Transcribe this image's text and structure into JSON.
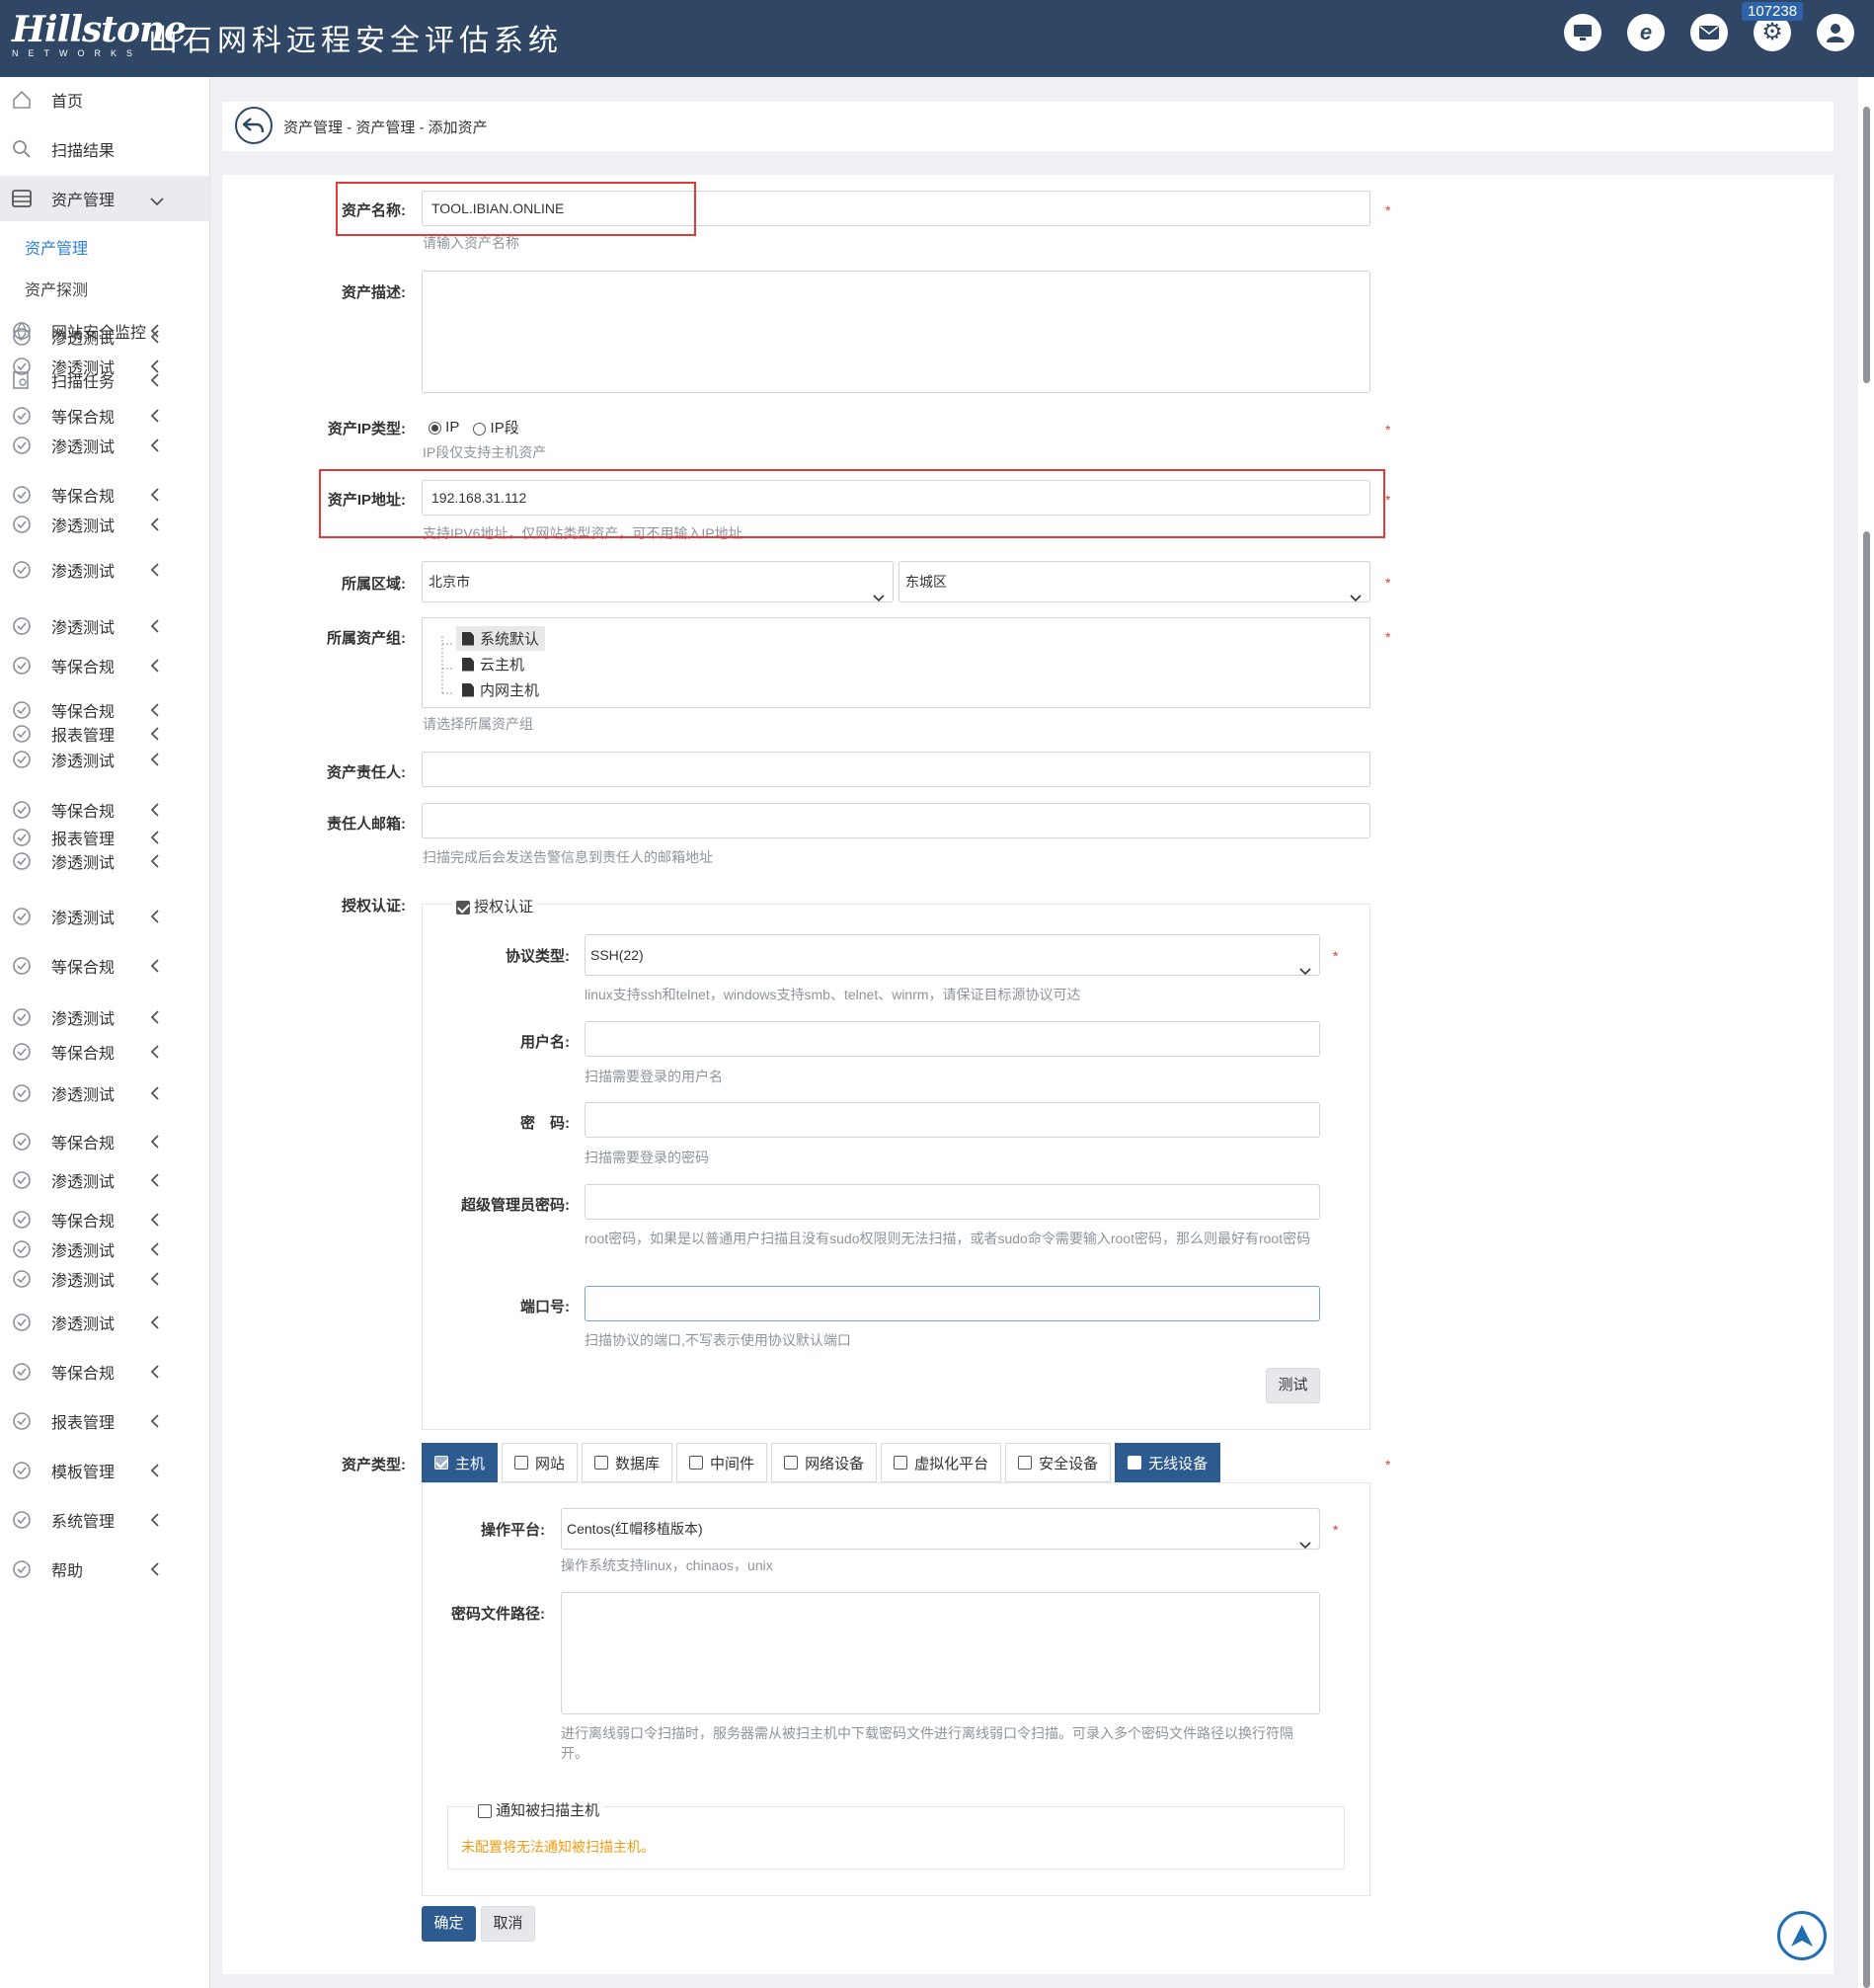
{
  "header": {
    "brand": "Hillstone",
    "brand_sub": "NETWORKS",
    "title": "山石网科远程安全评估系统",
    "badge_count": "107238",
    "icons": [
      "monitor-icon",
      "ie-icon",
      "mail-icon",
      "gear-icon",
      "user-icon"
    ]
  },
  "sidebar": {
    "items": [
      {
        "label": "首页",
        "icon": "home-icon"
      },
      {
        "label": "扫描结果",
        "icon": "search-icon"
      },
      {
        "label": "资产管理",
        "icon": "server-icon"
      },
      {
        "label": "网站安全监控",
        "icon": "globe-icon"
      },
      {
        "label": "扫描任务",
        "icon": "scan-task-icon"
      },
      {
        "label": "渗透测试",
        "icon": "pentest-icon"
      },
      {
        "label": "等保合规",
        "icon": "shield-icon"
      },
      {
        "label": "报表管理",
        "icon": "report-icon"
      },
      {
        "label": "模板管理",
        "icon": "template-icon"
      },
      {
        "label": "系统管理",
        "icon": "gear-icon"
      },
      {
        "label": "帮助",
        "icon": "help-icon"
      }
    ],
    "sub_items": [
      {
        "label": "资产管理"
      },
      {
        "label": "资产探测"
      }
    ]
  },
  "breadcrumb": "资产管理 - 资产管理 - 添加资产",
  "form": {
    "asset_name": {
      "label": "资产名称:",
      "value": "TOOL.IBIAN.ONLINE",
      "help": "请输入资产名称"
    },
    "asset_desc": {
      "label": "资产描述:",
      "value": ""
    },
    "ip_type": {
      "label": "资产IP类型:",
      "options": [
        "IP",
        "IP段"
      ],
      "selected": "IP",
      "help": "IP段仅支持主机资产"
    },
    "ip_addr": {
      "label": "资产IP地址:",
      "value": "192.168.31.112",
      "help": "支持IPV6地址，仅网站类型资产，可不用输入IP地址"
    },
    "region": {
      "label": "所属区域:",
      "city": "北京市",
      "district": "东城区"
    },
    "group": {
      "label": "所属资产组:",
      "items": [
        "系统默认",
        "云主机",
        "内网主机"
      ],
      "help": "请选择所属资产组"
    },
    "owner": {
      "label": "资产责任人:",
      "value": ""
    },
    "email": {
      "label": "责任人邮箱:",
      "value": "",
      "help": "扫描完成后会发送告警信息到责任人的邮箱地址"
    },
    "auth": {
      "label": "授权认证:",
      "checkbox_label": "授权认证",
      "checked": true,
      "protocol": {
        "label": "协议类型:",
        "value": "SSH(22)",
        "help": "linux支持ssh和telnet，windows支持smb、telnet、winrm，请保证目标源协议可达"
      },
      "username": {
        "label": "用户名:",
        "value": "",
        "help": "扫描需要登录的用户名"
      },
      "password": {
        "label": "密　码:",
        "value": "",
        "help": "扫描需要登录的密码"
      },
      "root_password": {
        "label": "超级管理员密码:",
        "value": "",
        "help": "root密码，如果是以普通用户扫描且没有sudo权限则无法扫描，或者sudo命令需要输入root密码，那么则最好有root密码"
      },
      "port": {
        "label": "端口号:",
        "value": "",
        "help": "扫描协议的端口,不写表示使用协议默认端口"
      },
      "test_button": "测试"
    },
    "asset_type": {
      "label": "资产类型:",
      "tabs": [
        "主机",
        "网站",
        "数据库",
        "中间件",
        "网络设备",
        "虚拟化平台",
        "安全设备",
        "无线设备"
      ],
      "checked": [
        "主机"
      ],
      "highlighted": [
        "主机",
        "无线设备"
      ],
      "platform": {
        "label": "操作平台:",
        "value": "Centos(红帽移植版本)",
        "help": "操作系统支持linux，chinaos，unix"
      },
      "pwd_file": {
        "label": "密码文件路径:",
        "value": "",
        "help": "进行离线弱口令扫描时，服务器需从被扫主机中下载密码文件进行离线弱口令扫描。可录入多个密码文件路径以换行符隔开。"
      },
      "notify": {
        "label": "通知被扫描主机",
        "checked": false,
        "warning": "未配置将无法通知被扫描主机。"
      }
    },
    "buttons": {
      "ok": "确定",
      "cancel": "取消"
    },
    "required_mark": "*"
  },
  "colors": {
    "header": "#2f4665",
    "accent": "#2d5a8f",
    "link": "#2d7fd6",
    "warning": "#f39c12",
    "required": "#e53b3b"
  }
}
